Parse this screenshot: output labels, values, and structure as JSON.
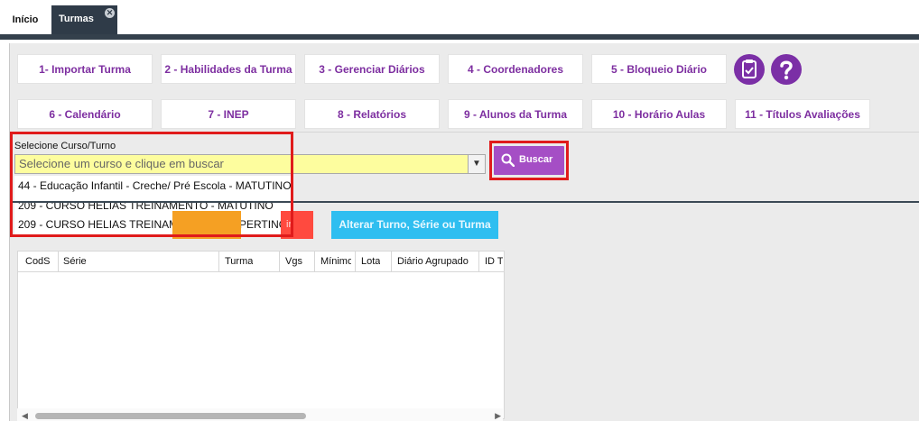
{
  "tabs": {
    "inicio": "Início",
    "turmas": "Turmas",
    "close": "✕"
  },
  "toolbar": {
    "row1": [
      "1- Importar Turma",
      "2 - Habilidades da Turma",
      "3 - Gerenciar Diários",
      "4 - Coordenadores",
      "5 - Bloqueio Diário"
    ],
    "row2": [
      "6 - Calendário",
      "7 - INEP",
      "8 - Relatórios",
      "9 - Alunos da Turma",
      "10 - Horário Aulas",
      "11 - Títulos Avaliações"
    ],
    "icons": [
      "clipboard-check-icon",
      "help-icon"
    ]
  },
  "filter": {
    "label": "Selecione Curso/Turno",
    "placeholder": "Selecione um curso e clique em buscar",
    "options": [
      "44 - Educação Infantil - Creche/ Pré Escola - MATUTINO",
      "209 - CURSO HELIAS TREINAMENTO - MATUTINO",
      "209 - CURSO HELIAS TREINAMENTO - VESPERTINO"
    ],
    "search_button": "Buscar"
  },
  "actions": {
    "partial_red": "ir",
    "alter_button": "Alterar Turno, Série ou Turma"
  },
  "grid": {
    "columns": [
      "CodS",
      "Série",
      "Turma",
      "Vgs",
      "Mínimo",
      "Lota",
      "Diário Agrupado",
      "ID T"
    ]
  },
  "colors": {
    "accent": "#7d2ea0",
    "highlight": "#e01b1b",
    "select_bg": "#fdfd9e"
  }
}
